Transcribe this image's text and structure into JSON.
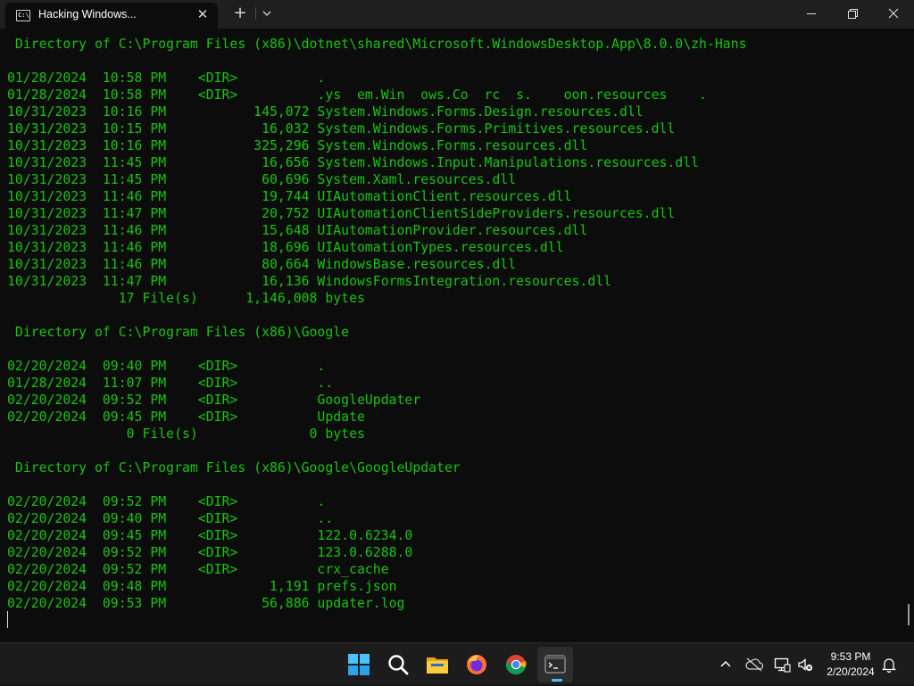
{
  "window": {
    "tab_title": "Hacking Windows...",
    "tab_icon_glyph": "C:\\",
    "new_tab_label": "+",
    "close_glyph": "✕"
  },
  "terminal": {
    "text_color": "#16c60c",
    "lines": [
      " Directory of C:\\Program Files (x86)\\dotnet\\shared\\Microsoft.WindowsDesktop.App\\8.0.0\\zh-Hans",
      "",
      "01/28/2024  10:58 PM    <DIR>          .",
      "01/28/2024  10:58 PM    <DIR>          .ys  em.Win  ows.Co  rc  s.    oon.resources    .",
      "10/31/2023  10:16 PM           145,072 System.Windows.Forms.Design.resources.dll",
      "10/31/2023  10:15 PM            16,032 System.Windows.Forms.Primitives.resources.dll",
      "10/31/2023  10:16 PM           325,296 System.Windows.Forms.resources.dll",
      "10/31/2023  11:45 PM            16,656 System.Windows.Input.Manipulations.resources.dll",
      "10/31/2023  11:45 PM            60,696 System.Xaml.resources.dll",
      "10/31/2023  11:46 PM            19,744 UIAutomationClient.resources.dll",
      "10/31/2023  11:47 PM            20,752 UIAutomationClientSideProviders.resources.dll",
      "10/31/2023  11:46 PM            15,648 UIAutomationProvider.resources.dll",
      "10/31/2023  11:46 PM            18,696 UIAutomationTypes.resources.dll",
      "10/31/2023  11:46 PM            80,664 WindowsBase.resources.dll",
      "10/31/2023  11:47 PM            16,136 WindowsFormsIntegration.resources.dll",
      "              17 File(s)      1,146,008 bytes",
      "",
      " Directory of C:\\Program Files (x86)\\Google",
      "",
      "02/20/2024  09:40 PM    <DIR>          .",
      "01/28/2024  11:07 PM    <DIR>          ..",
      "02/20/2024  09:52 PM    <DIR>          GoogleUpdater",
      "02/20/2024  09:45 PM    <DIR>          Update",
      "               0 File(s)              0 bytes",
      "",
      " Directory of C:\\Program Files (x86)\\Google\\GoogleUpdater",
      "",
      "02/20/2024  09:52 PM    <DIR>          .",
      "02/20/2024  09:40 PM    <DIR>          ..",
      "02/20/2024  09:45 PM    <DIR>          122.0.6234.0",
      "02/20/2024  09:52 PM    <DIR>          123.0.6288.0",
      "02/20/2024  09:52 PM    <DIR>          crx_cache",
      "02/20/2024  09:48 PM             1,191 prefs.json",
      "02/20/2024  09:53 PM            56,886 updater.log"
    ]
  },
  "taskbar": {
    "apps": [
      "start-icon",
      "search-icon",
      "file-explorer-icon",
      "firefox-icon",
      "chrome-icon",
      "terminal-icon"
    ],
    "active_app": "terminal-icon",
    "accent_color": "#4cc2ff",
    "clock": {
      "time": "9:53 PM",
      "date": "2/20/2024"
    }
  }
}
